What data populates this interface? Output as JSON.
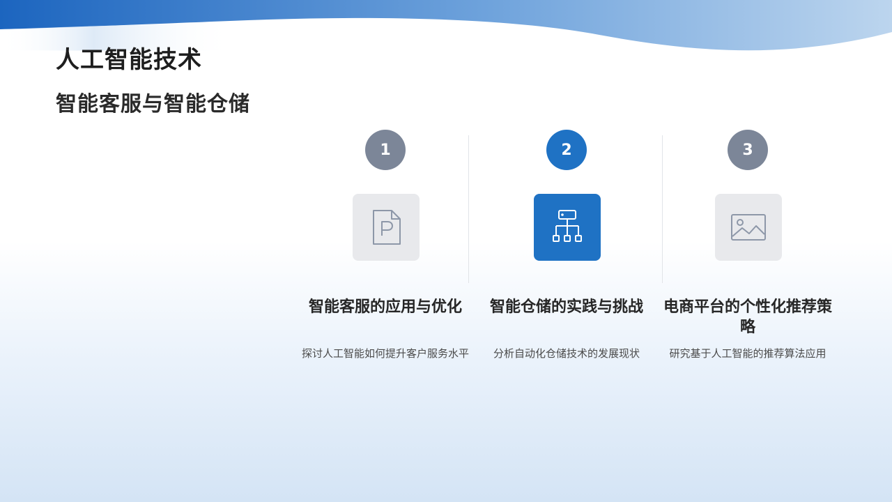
{
  "header": {
    "title": "人工智能技术",
    "subtitle": "智能客服与智能仓储"
  },
  "colors": {
    "accent": "#1f72c4",
    "muted_circle": "#7c8698",
    "icon_box_bg": "#e8e9ec",
    "icon_stroke_muted": "#8d97a8",
    "wave_dark": "#1c65bf",
    "wave_light": "#bcd5ee"
  },
  "steps": [
    {
      "number": "1",
      "icon": "ppt-file-icon",
      "title": "智能客服的应用与优化",
      "description": "探讨人工智能如何提升客户服务水平",
      "highlighted": false
    },
    {
      "number": "2",
      "icon": "hierarchy-tree-icon",
      "title": "智能仓储的实践与挑战",
      "description": "分析自动化仓储技术的发展现状",
      "highlighted": true
    },
    {
      "number": "3",
      "icon": "image-icon",
      "title": "电商平台的个性化推荐策略",
      "description": "研究基于人工智能的推荐算法应用",
      "highlighted": false
    }
  ]
}
